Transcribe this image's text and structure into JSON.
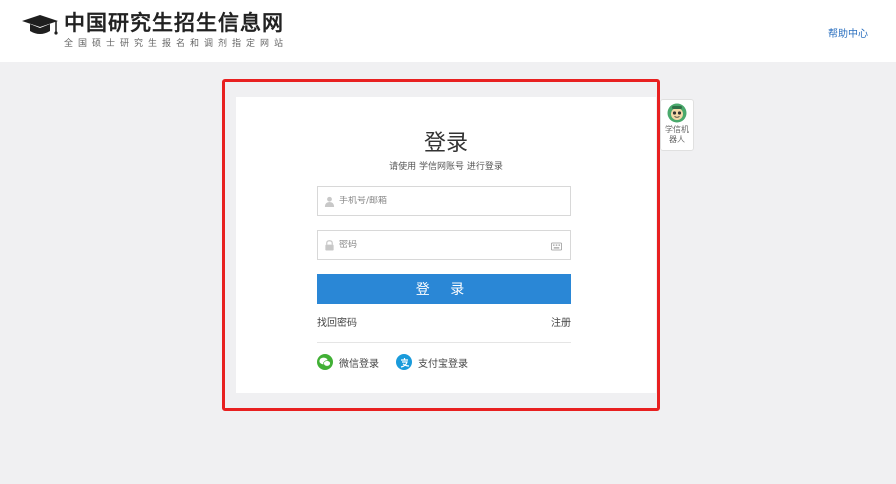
{
  "header": {
    "site_title": "中国研究生招生信息网",
    "site_subtitle": "全国硕士研究生报名和调剂指定网站",
    "help_link": "帮助中心"
  },
  "login": {
    "title": "登录",
    "subtitle": "请使用 学信网账号 进行登录",
    "username_placeholder": "手机号/邮箱",
    "password_placeholder": "密码",
    "submit_label": "登 录",
    "forgot_password": "找回密码",
    "register": "注册",
    "wechat_login": "微信登录",
    "alipay_login": "支付宝登录"
  },
  "robot": {
    "label": "学信机器人"
  },
  "colors": {
    "primary_button": "#2a87d6",
    "highlight_border": "#e82020",
    "wechat": "#41b035",
    "alipay": "#1a9bdb",
    "help_link": "#2a6fbf"
  }
}
